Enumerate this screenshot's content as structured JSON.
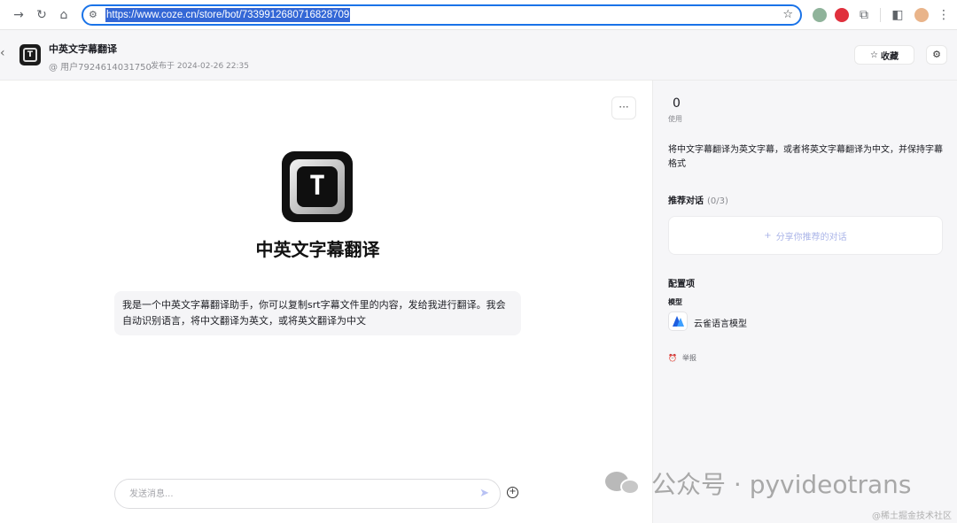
{
  "browser": {
    "url": "https://www.coze.cn/store/bot/7339912680716828709"
  },
  "header": {
    "bot_title": "中英文字幕翻译",
    "author": "@ 用户7924614031750",
    "published": "发布于 2024-02-26 22:35",
    "favorite_label": "收藏"
  },
  "main": {
    "more_label": "···",
    "logo_glyph": "T",
    "bot_name": "中英文字幕翻译",
    "intro": "我是一个中英文字幕翻译助手，你可以复制srt字幕文件里的内容，发给我进行翻译。我会自动识别语言，将中文翻译为英文，或将英文翻译为中文",
    "composer_placeholder": "发送消息..."
  },
  "side": {
    "uses_count": "0",
    "uses_label": "使用",
    "description": "将中文字幕翻译为英文字幕，或者将英文字幕翻译为中文，并保持字幕格式",
    "recommend_title": "推荐对话",
    "recommend_count": "(0/3)",
    "share_label": "分享你推荐的对话",
    "config_title": "配置项",
    "model_label": "模型",
    "model_name": "云雀语言模型",
    "report_label": "举报"
  },
  "watermark": {
    "primary": "公众号 · pyvideotrans",
    "secondary": "@稀土掘金技术社区"
  }
}
